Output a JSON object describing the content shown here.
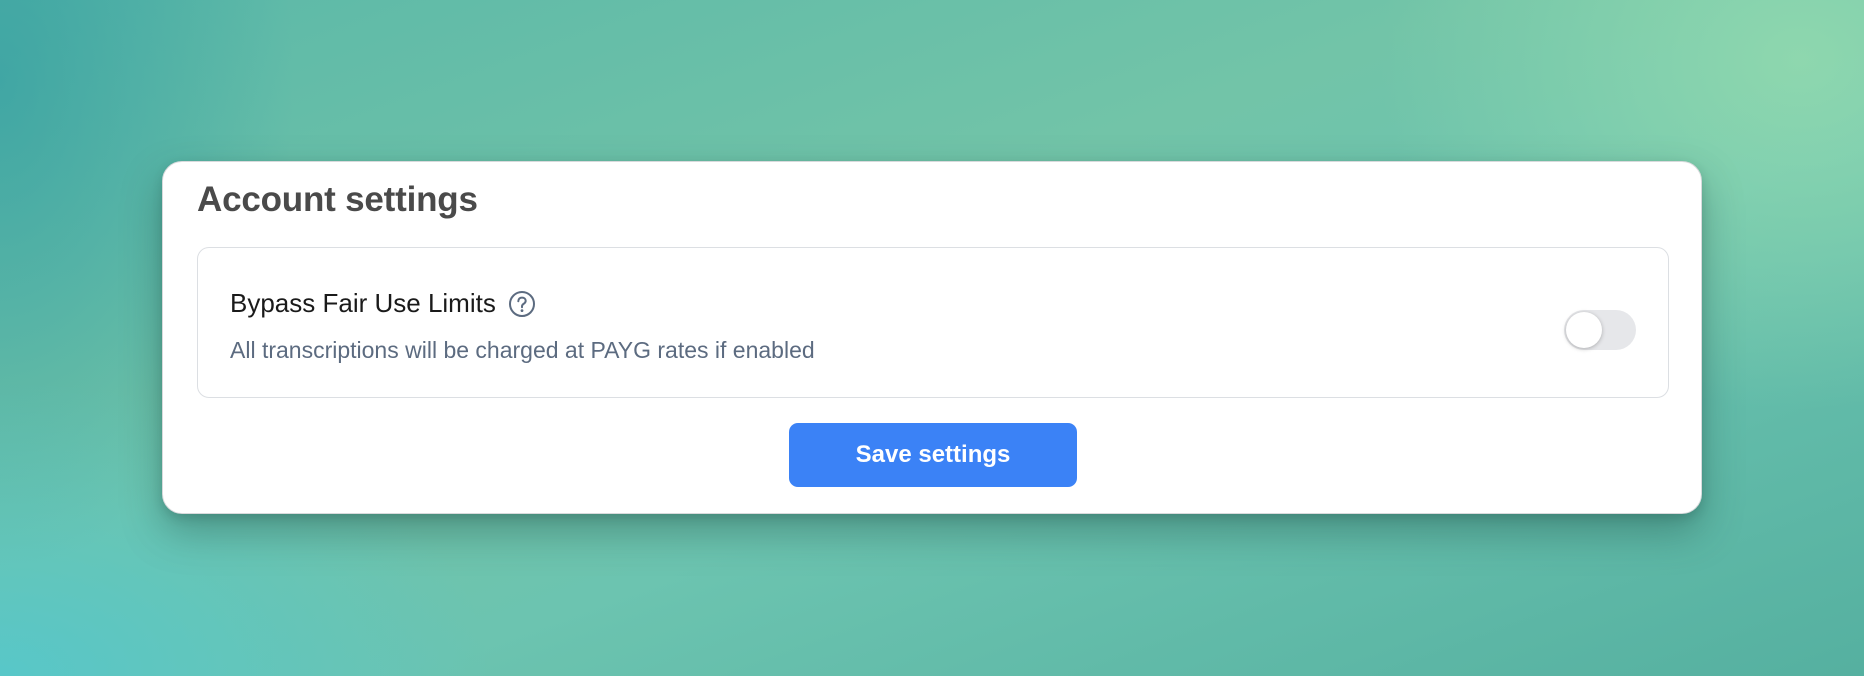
{
  "card": {
    "title": "Account settings"
  },
  "setting": {
    "label": "Bypass Fair Use Limits",
    "help_icon": "question-circle-icon",
    "description": "All transcriptions will be charged at PAYG rates if enabled",
    "enabled": false
  },
  "actions": {
    "save_label": "Save settings"
  },
  "colors": {
    "accent": "#3b82f6",
    "toggle_off": "#e6e7ea",
    "description_text": "#5c6b80"
  }
}
